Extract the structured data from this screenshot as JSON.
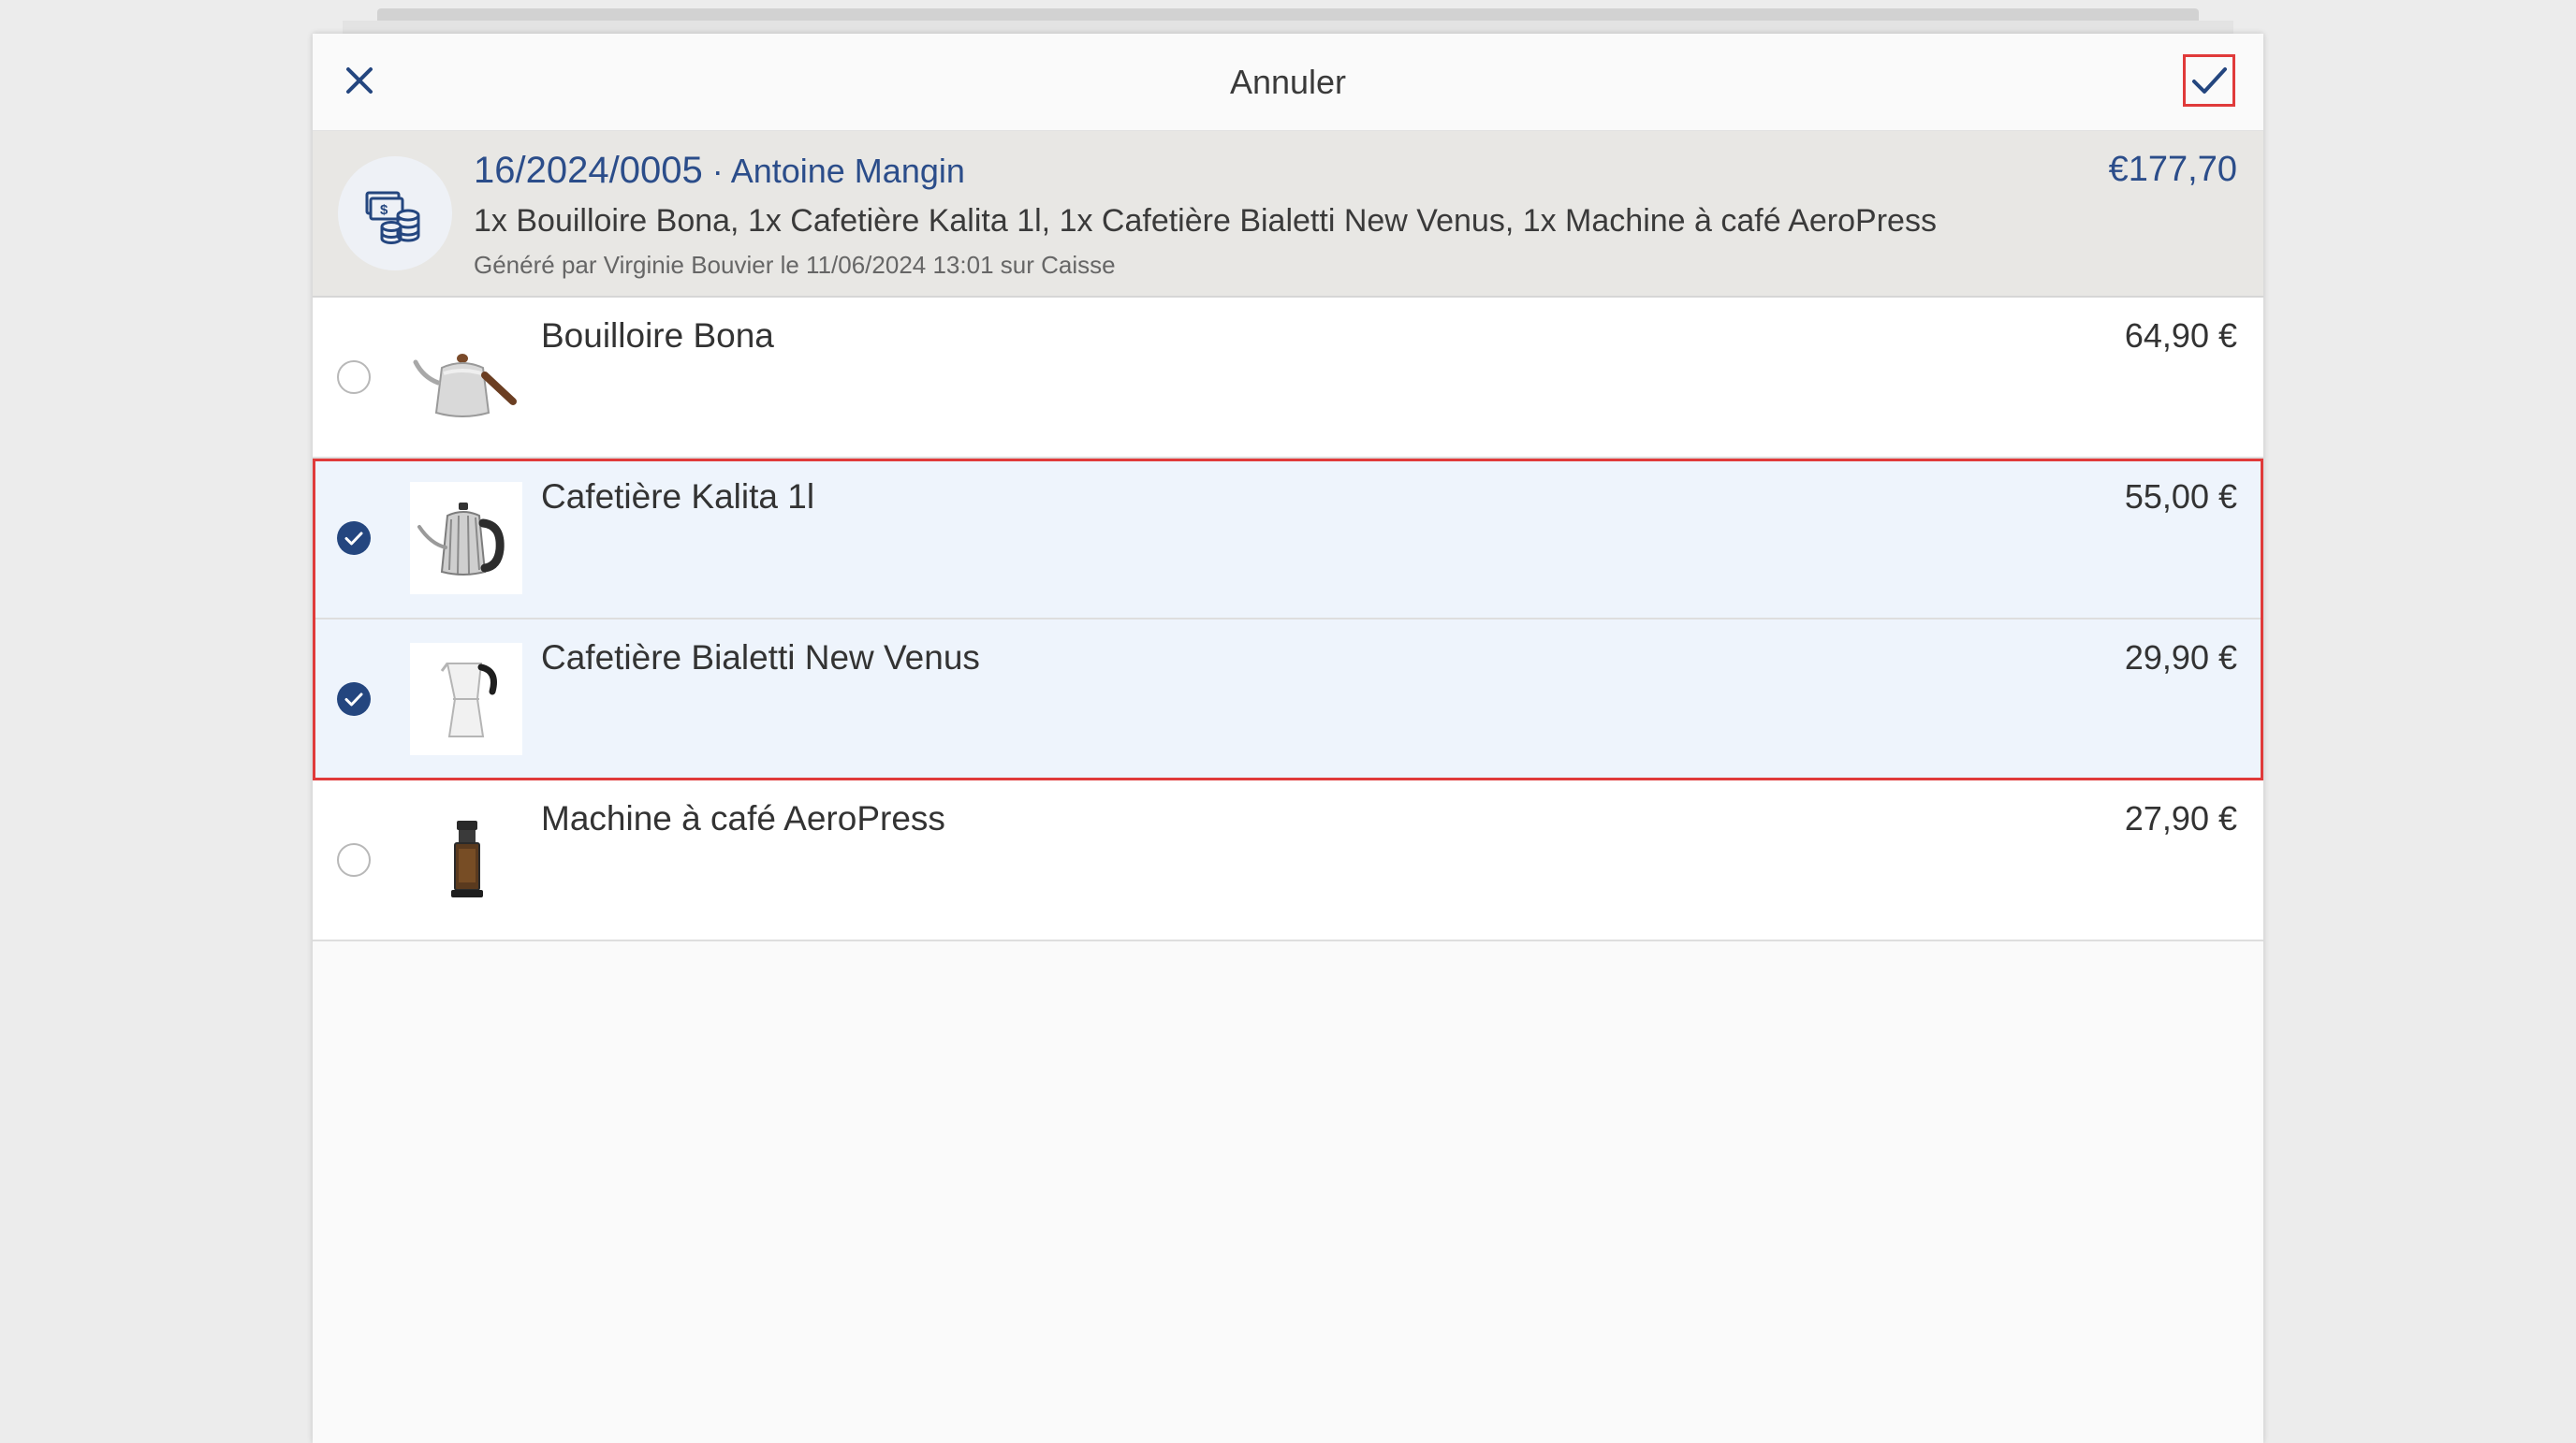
{
  "dialog": {
    "title": "Annuler",
    "close_icon": "close-icon",
    "confirm_icon": "check-icon"
  },
  "order": {
    "number": "16/2024/0005",
    "separator": " · ",
    "customer": "Antoine Mangin",
    "total": "€177,70",
    "items_summary": "1x Bouilloire Bona, 1x Cafetière Kalita 1l, 1x Cafetière Bialetti New Venus, 1x Machine à café AeroPress",
    "meta": "Généré par Virginie Bouvier le 11/06/2024 13:01 sur Caisse",
    "icon": "cash-coins-icon"
  },
  "items": [
    {
      "name": "Bouilloire Bona",
      "price": "64,90 €",
      "selected": false,
      "icon": "kettle-icon"
    },
    {
      "name": "Cafetière Kalita 1l",
      "price": "55,00 €",
      "selected": true,
      "icon": "pour-over-kettle-icon"
    },
    {
      "name": "Cafetière Bialetti New Venus",
      "price": "29,90 €",
      "selected": true,
      "icon": "moka-pot-icon"
    },
    {
      "name": "Machine à café AeroPress",
      "price": "27,90 €",
      "selected": false,
      "icon": "aeropress-icon"
    }
  ],
  "colors": {
    "accent": "#2b4d8a",
    "checked": "#24467f",
    "highlight": "#e03a3a",
    "selected_row": "#eef4fc",
    "header_bg": "#e8e7e4"
  }
}
